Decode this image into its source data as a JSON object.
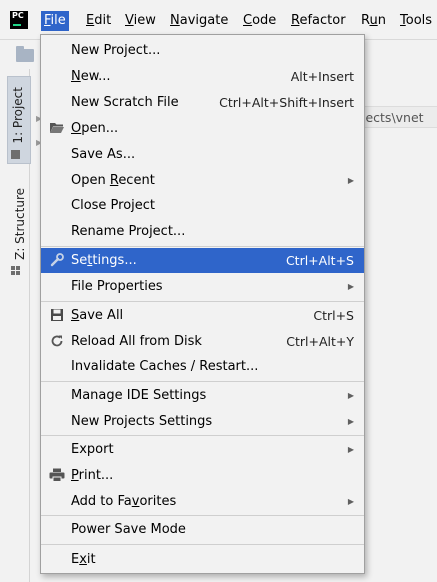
{
  "menubar": {
    "logo_text": "PC",
    "items": [
      {
        "pre": "",
        "mn": "F",
        "post": "ile"
      },
      {
        "pre": "",
        "mn": "E",
        "post": "dit"
      },
      {
        "pre": "",
        "mn": "V",
        "post": "iew"
      },
      {
        "pre": "",
        "mn": "N",
        "post": "avigate"
      },
      {
        "pre": "",
        "mn": "C",
        "post": "ode"
      },
      {
        "pre": "",
        "mn": "R",
        "post": "efactor"
      },
      {
        "pre": "R",
        "mn": "u",
        "post": "n"
      },
      {
        "pre": "",
        "mn": "T",
        "post": "ools"
      }
    ]
  },
  "left_strip": {
    "project_tab": "1: Project",
    "structure_tab": "Z: Structure"
  },
  "editor": {
    "path_fragment": "jects\\vnet"
  },
  "file_menu": {
    "items": [
      {
        "id": "new-project",
        "pre": "New Project...",
        "mn": "",
        "post": "",
        "shortcut": ""
      },
      {
        "id": "new",
        "pre": "",
        "mn": "N",
        "post": "ew...",
        "shortcut": "Alt+Insert"
      },
      {
        "id": "new-scratch-file",
        "pre": "New Scratch File",
        "mn": "",
        "post": "",
        "shortcut": "Ctrl+Alt+Shift+Insert"
      },
      {
        "id": "open",
        "pre": "",
        "mn": "O",
        "post": "pen...",
        "shortcut": ""
      },
      {
        "id": "save-as",
        "pre": "Save As...",
        "mn": "",
        "post": "",
        "shortcut": ""
      },
      {
        "id": "open-recent",
        "pre": "Open ",
        "mn": "R",
        "post": "ecent",
        "shortcut": ""
      },
      {
        "id": "close-project",
        "pre": "Close Project",
        "mn": "",
        "post": "",
        "shortcut": ""
      },
      {
        "id": "rename-project",
        "pre": "Rename Project...",
        "mn": "",
        "post": "",
        "shortcut": ""
      },
      {
        "id": "settings",
        "pre": "Se",
        "mn": "t",
        "post": "tings...",
        "shortcut": "Ctrl+Alt+S"
      },
      {
        "id": "file-properties",
        "pre": "File Properties",
        "mn": "",
        "post": "",
        "shortcut": ""
      },
      {
        "id": "save-all",
        "pre": "",
        "mn": "S",
        "post": "ave All",
        "shortcut": "Ctrl+S"
      },
      {
        "id": "reload-all",
        "pre": "Reload All from Disk",
        "mn": "",
        "post": "",
        "shortcut": "Ctrl+Alt+Y"
      },
      {
        "id": "invalidate-caches",
        "pre": "Invalidate Caches / Restart...",
        "mn": "",
        "post": "",
        "shortcut": ""
      },
      {
        "id": "manage-ide-settings",
        "pre": "Manage IDE Settings",
        "mn": "",
        "post": "",
        "shortcut": ""
      },
      {
        "id": "new-projects-settings",
        "pre": "New Projects Settings",
        "mn": "",
        "post": "",
        "shortcut": ""
      },
      {
        "id": "export",
        "pre": "Export",
        "mn": "",
        "post": "",
        "shortcut": ""
      },
      {
        "id": "print",
        "pre": "",
        "mn": "P",
        "post": "rint...",
        "shortcut": ""
      },
      {
        "id": "add-to-favorites",
        "pre": "Add to Fa",
        "mn": "v",
        "post": "orites",
        "shortcut": ""
      },
      {
        "id": "power-save-mode",
        "pre": "Power Save Mode",
        "mn": "",
        "post": "",
        "shortcut": ""
      },
      {
        "id": "exit",
        "pre": "E",
        "mn": "x",
        "post": "it",
        "shortcut": ""
      }
    ]
  },
  "icons": {
    "open": "folder-open-icon",
    "settings": "wrench-icon",
    "save_all": "floppy-disk-icon",
    "reload": "reload-icon",
    "print": "printer-icon",
    "submenu": "submenu-arrow-icon"
  },
  "colors": {
    "selection": "#2f65ca",
    "menu_background": "#f2f2f2",
    "separator": "#cfcfcf"
  },
  "selected_item": "settings"
}
